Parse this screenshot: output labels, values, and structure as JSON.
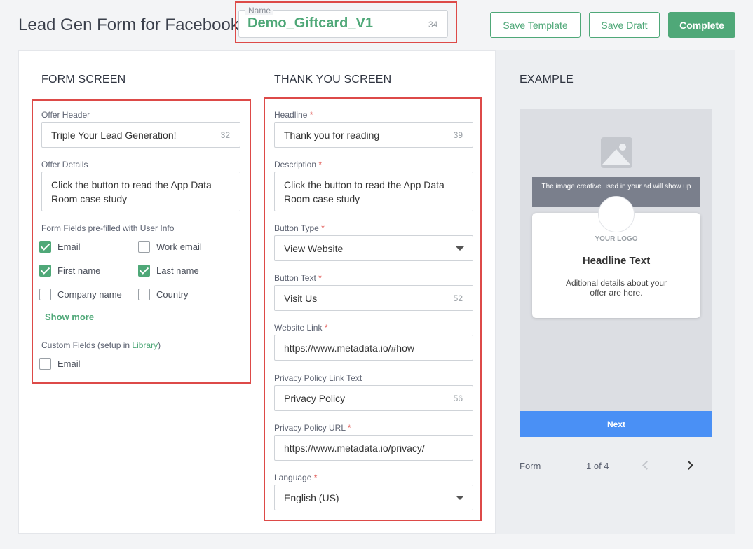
{
  "header": {
    "title": "Lead Gen Form for Facebook",
    "name_legend": "Name",
    "name_value": "Demo_Giftcard_V1",
    "name_count": "34",
    "save_template": "Save Template",
    "save_draft": "Save Draft",
    "complete": "Complete"
  },
  "form_screen": {
    "title": "FORM SCREEN",
    "offer_header_label": "Offer Header",
    "offer_header_value": "Triple Your Lead Generation!",
    "offer_header_count": "32",
    "offer_details_label": "Offer Details",
    "offer_details_value": "Click the button to read the App Data Room case study",
    "prefilled_label": "Form Fields pre-filled with User Info",
    "fields": [
      {
        "label": "Email",
        "checked": true
      },
      {
        "label": "Work email",
        "checked": false
      },
      {
        "label": "First name",
        "checked": true
      },
      {
        "label": "Last name",
        "checked": true
      },
      {
        "label": "Company name",
        "checked": false
      },
      {
        "label": "Country",
        "checked": false
      }
    ],
    "show_more": "Show more",
    "custom_fields_prefix": "Custom Fields (setup in ",
    "custom_fields_link": "Library",
    "custom_fields_suffix": ")",
    "custom_fields": [
      {
        "label": "Email",
        "checked": false
      }
    ]
  },
  "thank_you": {
    "title": "THANK YOU SCREEN",
    "headline_label": "Headline",
    "headline_value": "Thank you for reading",
    "headline_count": "39",
    "description_label": "Description",
    "description_value": "Click the button to read the App Data Room case study",
    "button_type_label": "Button Type",
    "button_type_value": "View Website",
    "button_text_label": "Button Text",
    "button_text_value": "Visit Us",
    "button_text_count": "52",
    "website_link_label": "Website Link",
    "website_link_value": "https://www.metadata.io/#how",
    "privacy_text_label": "Privacy Policy Link Text",
    "privacy_text_value": "Privacy Policy",
    "privacy_text_count": "56",
    "privacy_url_label": "Privacy Policy URL",
    "privacy_url_value": "https://www.metadata.io/privacy/",
    "language_label": "Language",
    "language_value": "English (US)",
    "required_mark": "*"
  },
  "example": {
    "title": "EXAMPLE",
    "banner_text": "The image creative used in your ad will show up",
    "logo_text": "YOUR LOGO",
    "headline": "Headline Text",
    "description": "Aditional details about your offer are here.",
    "next_label": "Next",
    "pager_label": "Form",
    "pager_count": "1 of 4"
  },
  "colors": {
    "accent": "#4fa878",
    "highlight": "#dd4a48",
    "next_button": "#4a90f5"
  },
  "icons": [
    "image-placeholder-icon",
    "chevron-down-icon",
    "chevron-left-icon",
    "chevron-right-icon",
    "checkmark-icon"
  ]
}
